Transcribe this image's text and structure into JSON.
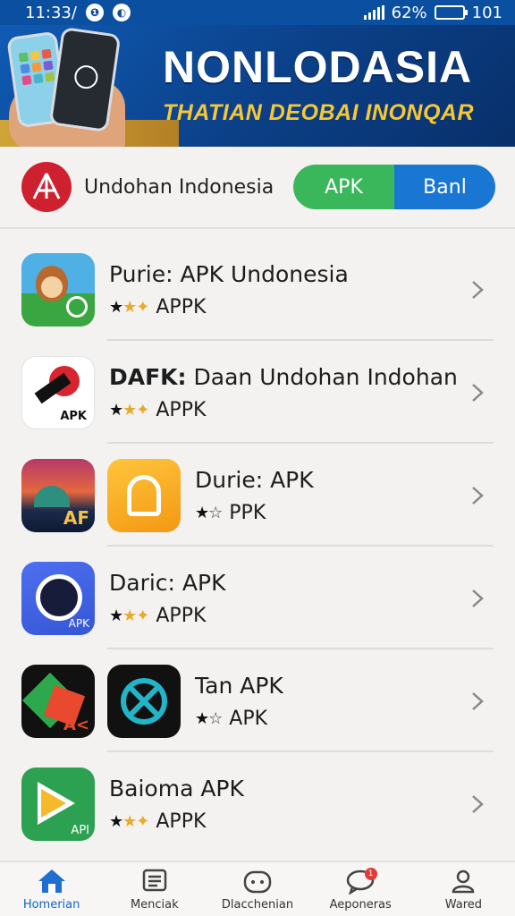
{
  "status_bar": {
    "time": "11:33/",
    "battery_percent": "62%",
    "extra": "101",
    "battery_level": 0.62
  },
  "banner": {
    "title": "NONLODASIA",
    "subtitle": "THATIAN DEOBAI INONQAR"
  },
  "header": {
    "brand_name": "Undohan Indonesia",
    "toggle_left": "APK",
    "toggle_right": "Banl"
  },
  "apps": [
    {
      "title": "Purie: APK Undonesia",
      "subtitle": "APPK",
      "stars": "two-gold"
    },
    {
      "title_bold": "DAFK:",
      "title": "Daan Undohan Indohan",
      "subtitle": "APPK",
      "stars": "two-gold"
    },
    {
      "title": "Durie: APK",
      "subtitle": "PPK",
      "stars": "one-outline"
    },
    {
      "title": "Daric: APK",
      "subtitle": "APPK",
      "stars": "two-gold"
    },
    {
      "title": "Tan APK",
      "subtitle": "APK",
      "stars": "one-outline"
    },
    {
      "title": "Baioma APK",
      "subtitle": "APPK",
      "stars": "two-gold"
    }
  ],
  "icon_labels": {
    "pin": "APK",
    "city": "AF",
    "camera": "APK",
    "cube": "A<",
    "play": "API"
  },
  "bottom_nav": [
    {
      "label": "Homerian",
      "icon": "home-icon",
      "active": true
    },
    {
      "label": "Menciak",
      "icon": "list-icon"
    },
    {
      "label": "Dlacchenian",
      "icon": "gamepad-icon"
    },
    {
      "label": "Aeponeras",
      "icon": "chat-icon",
      "badge": "1"
    },
    {
      "label": "Wared",
      "icon": "user-icon"
    }
  ],
  "colors": {
    "primary_blue": "#1976d2",
    "green": "#3ab65b",
    "brand_red": "#cf2030",
    "gold": "#f6c737"
  }
}
